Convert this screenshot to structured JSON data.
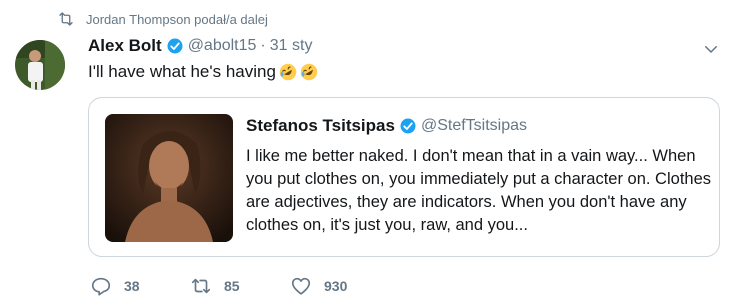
{
  "retweet_context": {
    "text": "Jordan Thompson podał/a dalej"
  },
  "tweet": {
    "author_name": "Alex Bolt",
    "handle": "@abolt15",
    "separator": "·",
    "date": "31 sty",
    "text": "I'll have what he's having",
    "emojis": [
      "rolling-on-floor-laughing-emoji",
      "rolling-on-floor-laughing-emoji"
    ]
  },
  "quoted_tweet": {
    "author_name": "Stefanos Tsitsipas",
    "handle": "@StefTsitsipas",
    "text": "I like me better naked. I don't mean that in a vain way... When you put clothes on, you immediately put a character on. Clothes are adjectives, they are indicators. When you don't have any clothes on, it's just you, raw, and you..."
  },
  "actions": {
    "reply_count": "38",
    "retweet_count": "85",
    "like_count": "930"
  },
  "colors": {
    "accent": "#1da1f2",
    "muted": "#657786",
    "border": "#ccd6dd"
  }
}
